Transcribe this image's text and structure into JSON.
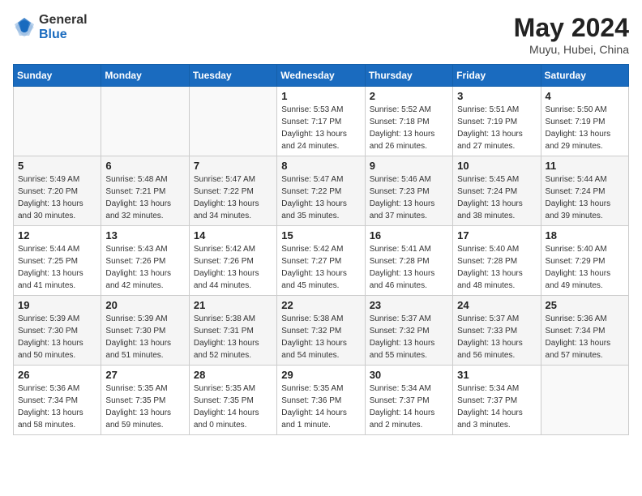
{
  "logo": {
    "general": "General",
    "blue": "Blue"
  },
  "title": "May 2024",
  "location": "Muyu, Hubei, China",
  "days_header": [
    "Sunday",
    "Monday",
    "Tuesday",
    "Wednesday",
    "Thursday",
    "Friday",
    "Saturday"
  ],
  "weeks": [
    [
      {
        "day": "",
        "info": ""
      },
      {
        "day": "",
        "info": ""
      },
      {
        "day": "",
        "info": ""
      },
      {
        "day": "1",
        "info": "Sunrise: 5:53 AM\nSunset: 7:17 PM\nDaylight: 13 hours\nand 24 minutes."
      },
      {
        "day": "2",
        "info": "Sunrise: 5:52 AM\nSunset: 7:18 PM\nDaylight: 13 hours\nand 26 minutes."
      },
      {
        "day": "3",
        "info": "Sunrise: 5:51 AM\nSunset: 7:19 PM\nDaylight: 13 hours\nand 27 minutes."
      },
      {
        "day": "4",
        "info": "Sunrise: 5:50 AM\nSunset: 7:19 PM\nDaylight: 13 hours\nand 29 minutes."
      }
    ],
    [
      {
        "day": "5",
        "info": "Sunrise: 5:49 AM\nSunset: 7:20 PM\nDaylight: 13 hours\nand 30 minutes."
      },
      {
        "day": "6",
        "info": "Sunrise: 5:48 AM\nSunset: 7:21 PM\nDaylight: 13 hours\nand 32 minutes."
      },
      {
        "day": "7",
        "info": "Sunrise: 5:47 AM\nSunset: 7:22 PM\nDaylight: 13 hours\nand 34 minutes."
      },
      {
        "day": "8",
        "info": "Sunrise: 5:47 AM\nSunset: 7:22 PM\nDaylight: 13 hours\nand 35 minutes."
      },
      {
        "day": "9",
        "info": "Sunrise: 5:46 AM\nSunset: 7:23 PM\nDaylight: 13 hours\nand 37 minutes."
      },
      {
        "day": "10",
        "info": "Sunrise: 5:45 AM\nSunset: 7:24 PM\nDaylight: 13 hours\nand 38 minutes."
      },
      {
        "day": "11",
        "info": "Sunrise: 5:44 AM\nSunset: 7:24 PM\nDaylight: 13 hours\nand 39 minutes."
      }
    ],
    [
      {
        "day": "12",
        "info": "Sunrise: 5:44 AM\nSunset: 7:25 PM\nDaylight: 13 hours\nand 41 minutes."
      },
      {
        "day": "13",
        "info": "Sunrise: 5:43 AM\nSunset: 7:26 PM\nDaylight: 13 hours\nand 42 minutes."
      },
      {
        "day": "14",
        "info": "Sunrise: 5:42 AM\nSunset: 7:26 PM\nDaylight: 13 hours\nand 44 minutes."
      },
      {
        "day": "15",
        "info": "Sunrise: 5:42 AM\nSunset: 7:27 PM\nDaylight: 13 hours\nand 45 minutes."
      },
      {
        "day": "16",
        "info": "Sunrise: 5:41 AM\nSunset: 7:28 PM\nDaylight: 13 hours\nand 46 minutes."
      },
      {
        "day": "17",
        "info": "Sunrise: 5:40 AM\nSunset: 7:28 PM\nDaylight: 13 hours\nand 48 minutes."
      },
      {
        "day": "18",
        "info": "Sunrise: 5:40 AM\nSunset: 7:29 PM\nDaylight: 13 hours\nand 49 minutes."
      }
    ],
    [
      {
        "day": "19",
        "info": "Sunrise: 5:39 AM\nSunset: 7:30 PM\nDaylight: 13 hours\nand 50 minutes."
      },
      {
        "day": "20",
        "info": "Sunrise: 5:39 AM\nSunset: 7:30 PM\nDaylight: 13 hours\nand 51 minutes."
      },
      {
        "day": "21",
        "info": "Sunrise: 5:38 AM\nSunset: 7:31 PM\nDaylight: 13 hours\nand 52 minutes."
      },
      {
        "day": "22",
        "info": "Sunrise: 5:38 AM\nSunset: 7:32 PM\nDaylight: 13 hours\nand 54 minutes."
      },
      {
        "day": "23",
        "info": "Sunrise: 5:37 AM\nSunset: 7:32 PM\nDaylight: 13 hours\nand 55 minutes."
      },
      {
        "day": "24",
        "info": "Sunrise: 5:37 AM\nSunset: 7:33 PM\nDaylight: 13 hours\nand 56 minutes."
      },
      {
        "day": "25",
        "info": "Sunrise: 5:36 AM\nSunset: 7:34 PM\nDaylight: 13 hours\nand 57 minutes."
      }
    ],
    [
      {
        "day": "26",
        "info": "Sunrise: 5:36 AM\nSunset: 7:34 PM\nDaylight: 13 hours\nand 58 minutes."
      },
      {
        "day": "27",
        "info": "Sunrise: 5:35 AM\nSunset: 7:35 PM\nDaylight: 13 hours\nand 59 minutes."
      },
      {
        "day": "28",
        "info": "Sunrise: 5:35 AM\nSunset: 7:35 PM\nDaylight: 14 hours\nand 0 minutes."
      },
      {
        "day": "29",
        "info": "Sunrise: 5:35 AM\nSunset: 7:36 PM\nDaylight: 14 hours\nand 1 minute."
      },
      {
        "day": "30",
        "info": "Sunrise: 5:34 AM\nSunset: 7:37 PM\nDaylight: 14 hours\nand 2 minutes."
      },
      {
        "day": "31",
        "info": "Sunrise: 5:34 AM\nSunset: 7:37 PM\nDaylight: 14 hours\nand 3 minutes."
      },
      {
        "day": "",
        "info": ""
      }
    ]
  ]
}
